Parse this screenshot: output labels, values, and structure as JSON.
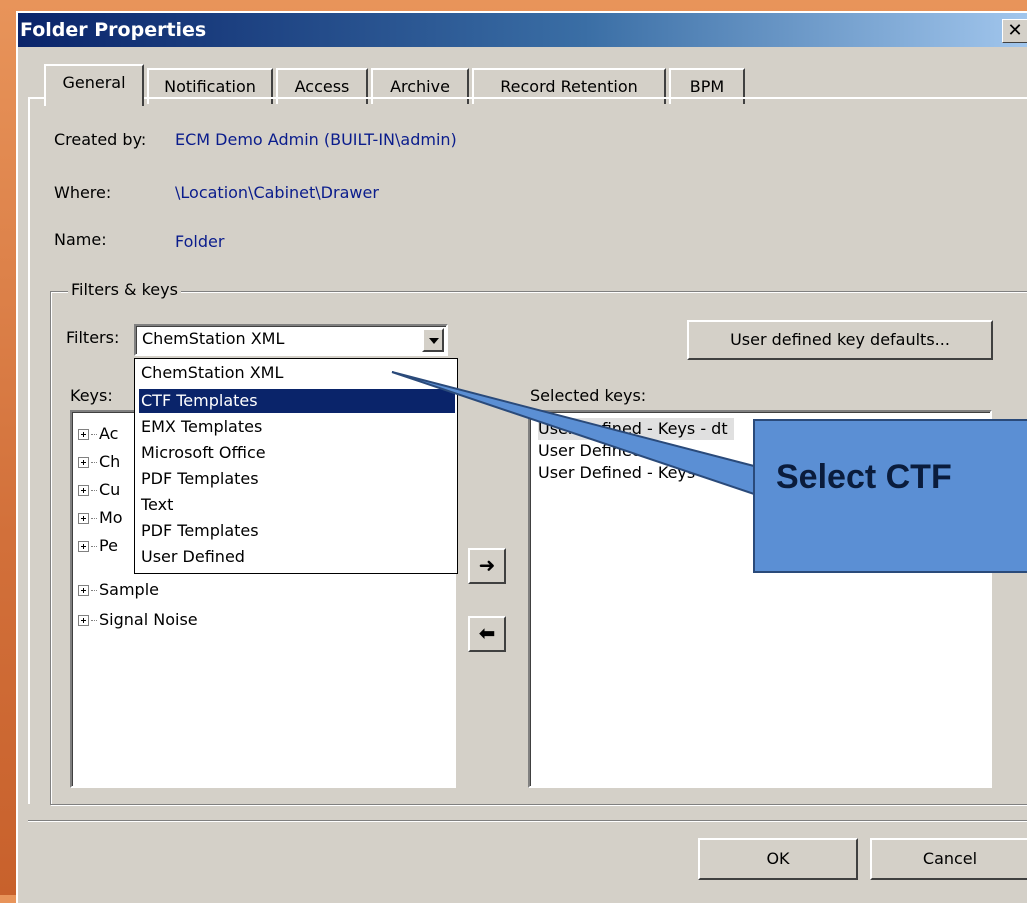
{
  "window": {
    "title": "Folder Properties",
    "close_glyph": "✕"
  },
  "tabs": [
    {
      "label": "General"
    },
    {
      "label": "Notification"
    },
    {
      "label": "Access"
    },
    {
      "label": "Archive"
    },
    {
      "label": "Record Retention"
    },
    {
      "label": "BPM"
    }
  ],
  "info": {
    "created_by_label": "Created by:",
    "created_by_value": "ECM Demo Admin (BUILT-IN\\admin)",
    "where_label": "Where:",
    "where_value": "\\Location\\Cabinet\\Drawer",
    "name_label": "Name:",
    "name_value": "Folder"
  },
  "filters_keys": {
    "group_title": "Filters & keys",
    "filters_label": "Filters:",
    "filters_selected": "ChemStation XML",
    "user_defined_button": "User defined key defaults...",
    "keys_label": "Keys:",
    "selected_keys_label": "Selected keys:"
  },
  "dropdown_options": [
    "ChemStation XML",
    "CTF Templates",
    "EMX Templates",
    "Microsoft Office",
    "PDF Templates",
    "Text",
    "PDF Templates",
    "User Defined"
  ],
  "dropdown_highlighted_index": 1,
  "keys_tree": [
    "Ac",
    "Ch",
    "Cu",
    "Mo",
    "Pe",
    "Sample",
    "Signal Noise"
  ],
  "selected_keys": [
    "User Defined - Keys - dt",
    "User Defined",
    "User Defined - Keys -"
  ],
  "arrows": {
    "add": "➜",
    "remove": "⬅"
  },
  "buttons": {
    "ok": "OK",
    "cancel": "Cancel"
  },
  "callout": {
    "text": "Select CTF",
    "fill": "#5b8fd4",
    "stroke": "#2a4a7a"
  },
  "colors": {
    "title_bar": "#0a246a",
    "dialog_bg": "#d4d0c8",
    "link_text": "#0a1c8c",
    "highlight": "#0a246a"
  }
}
